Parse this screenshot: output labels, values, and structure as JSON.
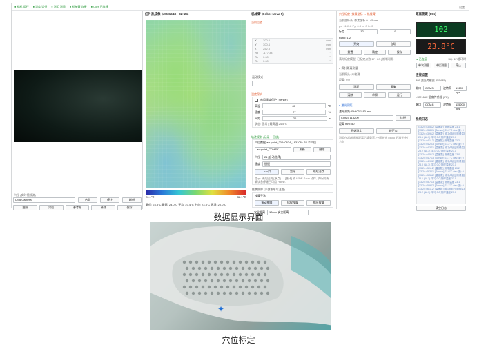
{
  "top_status": [
    "● 相机 运行",
    "● 温度 运行",
    "● 测距 测量",
    "● 机械臂 连接",
    "● Core 已连接"
  ],
  "top_settings": "设置",
  "camera": {
    "label": "穴位 (实时视频流)",
    "device": "USB Camera",
    "btn_open": "启动",
    "btn_stop": "停止",
    "btn_refresh": "刷新",
    "actions": [
      "拍照",
      "穴位",
      "参考框",
      "清除",
      "保存"
    ]
  },
  "thermal": {
    "title": "红外热成像 (LSM164X · 32×24)",
    "scale_min": "20.1℃",
    "scale_max": "32.1℃",
    "stats": "最低: 23.3°C  最高: 23.0°C  平均: 23.4°C  中心: 23.3°C  环境: 20.0°C"
  },
  "robot": {
    "title": "机械臂 (Dobot Nova 5)",
    "pose_title": "当前位姿",
    "pose": [
      {
        "k": "X",
        "v": "200.0",
        "u": "mm"
      },
      {
        "k": "Y",
        "v": "300.4",
        "u": "mm"
      },
      {
        "k": "Z",
        "v": "252.5",
        "u": "mm"
      },
      {
        "k": "Rx",
        "v": "-177.34",
        "u": "°"
      },
      {
        "k": "Ry",
        "v": "0.00",
        "u": "°"
      },
      {
        "k": "Rz",
        "v": "0.00",
        "u": "°"
      }
    ],
    "mode_label": "运动模式",
    "safety_title": "温度保护",
    "safety_toggle": "启用温度保护 (SenoF)",
    "fields": [
      {
        "k": "高温",
        "v": "80",
        "u": "℃"
      },
      {
        "k": "速度",
        "v": "27",
        "u": "%"
      },
      {
        "k": "间距",
        "v": "20",
        "u": "s"
      }
    ],
    "status_line": "状态: 正常 | 最高温 24.5°C",
    "traj_title": "轨迹规划 (记录 + 回放)",
    "traj_file": "穴位数据 acupoint_20240624_193106 · 32 个穴位",
    "traj_select": "acupoint_CDMSK",
    "traj_btn1": "刷新",
    "traj_btn2": "删除",
    "point_label": "穴位",
    "point_value": "21 [自动选择]",
    "speed_label": "速度",
    "speed_value": "慢速",
    "step_btns": [
      "下一穴",
      "暂停",
      "继续治疗"
    ],
    "note": "提示: 请先回到 [原点] → [循环] 或 ISDE Save 动作, 执行前请确认急停键已可用 Home.",
    "force_title": "推拿按摩 (手部按摩与温控)",
    "force_label": "按摩手法",
    "force_tabs": [
      "振动按摩",
      "揉捏按摩",
      "指压按摩"
    ],
    "distance_label": "安全距离",
    "distance_value": "10mm 安全距离"
  },
  "calib": {
    "title": "穴位标定 (像素坐标 ↔ 机械臂)",
    "coord": "当前坐标系: 像素坐标 0.145 mm",
    "pixel": "px: 1131.2  Py: 6.8  Ix: 0  Iy: 0",
    "num_label": "标定",
    "num_a": "12",
    "num_b": "9",
    "ratio_label": "Ratio: 1.2",
    "btn_start": "开始",
    "btn_auto": "自动",
    "reset": "重置",
    "confirm": "确定",
    "save": "保存",
    "hint": "请先标定模型, 已标定点数 17 / 20 (点阵间隔)",
    "probe_title": "● 探针距离测量",
    "probe_status": "当前探头: 未检测",
    "probe_line": "距离: 0.0",
    "probe_btns": [
      "测距",
      "采集"
    ],
    "probe_btns2": [
      "清除",
      "求解",
      "运行"
    ],
    "laser_title": "● 激光测距",
    "laser_model": "激光测距: RH-03 1-83 mm",
    "laser_port": "COM5 115200",
    "laser_connect": "连接",
    "laser_dist": "距离 mm: 50",
    "laser_btn1": "开始测定",
    "laser_btn2": "矫正点",
    "laser_note": "测距在超越标准距离后请重置, 中间激光 Micro 的激光中心方向"
  },
  "monitor": {
    "title": "距离测距 (895)",
    "distance": "102",
    "temp": "23.8°C",
    "conn": "● 已连接",
    "rate": "SQ: 4F/循环时",
    "btns": [
      "单次测量",
      "持续测量",
      "停止"
    ],
    "setting_title": "连接设置",
    "sensor_title": "895 激光传感器 (RS485)",
    "port_label": "端口",
    "port_value": "COM3",
    "baud_label": "波特率",
    "baud_value": "19200 bps",
    "sensor2_title": "LSM164X 温度传感器 (I²C)",
    "port2_value": "COM4",
    "baud2_value": "115200 bps",
    "log_title": "系统日志",
    "log": [
      "[13:24:43.512] [温度数] 测得温度 23.1",
      "[13:24:43.891] [Sensor] 23.0°C dev: 距: 0",
      "[13:24:43.912] [温度数] [成功响应] 测得温度",
      "23.1 (18.3) 平均 0.0 测得温度 23.0",
      "[13:24:44.112] [温度数] 测得温度 23.2",
      "[13:24:44.203] [Sensor] 23.2°C dev: 距: 0",
      "[13:24:44.371] [温度数] [成功响应] 测得温度",
      "23.2 (18.3) 平均 0.0 测得温度 23.1",
      "[13:24:44.512] [温度数] 测得温度 23.0",
      "[13:24:44.713] [Sensor] 23.1°C dev: 距: 0",
      "[13:24:44.902] [温度数] [成功响应] 测得温度",
      "23.0 (18.3) 平均 0.0 测得温度 23.1",
      "[13:24:45.112] [温度数] 测得温度 23.2",
      "[13:24:45.301] [Sensor] 23.0°C dev: 距: 0",
      "[13:24:45.512] [温度数] [成功响应] 测得温度",
      "23.1 (18.3) 平均 0.0 测得温度 23.0",
      "[13:24:45.713] [温度数] 测得温度 23.1",
      "[13:24:45.902] [Sensor] 23.1°C dev: 距: 0",
      "[13:24:46.112] [温度数] [成功响应] 测得温度",
      "23.2 (18.3) 平均 0.0 测得温度 23.1"
    ],
    "clear_log": "清空日志"
  },
  "captions": {
    "ui": "数据显示界面",
    "photo": "穴位标定"
  }
}
